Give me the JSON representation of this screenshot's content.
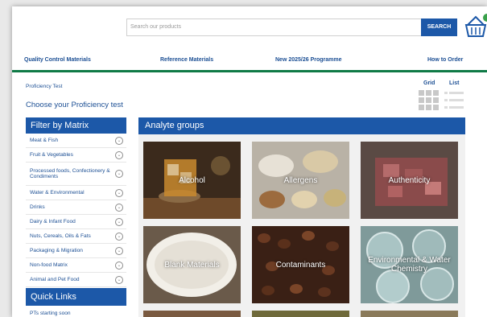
{
  "header": {
    "search_placeholder": "Search our products",
    "search_button": "SEARCH"
  },
  "nav": [
    "Quality Control Materials",
    "Reference Materials",
    "New 2025/26 Programme",
    "How to Order"
  ],
  "breadcrumb": "Proficiency Test",
  "page_title": "Choose your Proficiency test",
  "view": {
    "grid": "Grid",
    "list": "List"
  },
  "sidebar": {
    "filter_title": "Filter by Matrix",
    "items": [
      "Meat & Fish",
      "Fruit & Vegetables",
      "Processed foods, Confectionery & Condiments",
      "Water & Environmental",
      "Drinks",
      "Dairy & Infant Food",
      "Nuts, Cereals, Oils & Fats",
      "Packaging & Migration",
      "Non-food Matrix",
      "Animal and Pet Food"
    ],
    "quick_links_title": "Quick Links",
    "quick_links": [
      "PTs starting soon"
    ]
  },
  "main": {
    "title": "Analyte groups",
    "tiles": [
      "Alcohol",
      "Allergens",
      "Authenticity",
      "Blank Materials",
      "Contaminants",
      "Environmental & Water Chemistry"
    ]
  },
  "colors": {
    "brand_blue": "#1c58a8",
    "accent_green": "#0f7a46",
    "badge_green": "#3aa14b"
  }
}
